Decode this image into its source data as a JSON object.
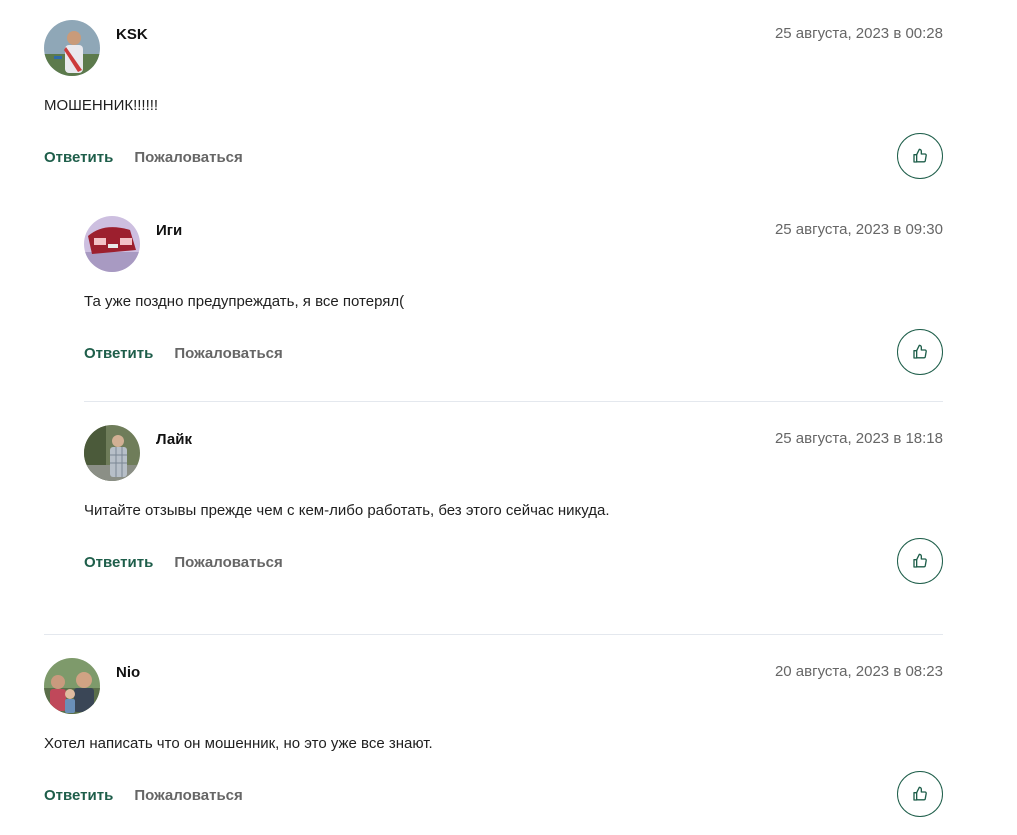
{
  "comments": [
    {
      "author": "KSK",
      "date": "25 августа, 2023 в 00:28",
      "text": "МОШЕННИК!!!!!!",
      "reply_label": "Ответить",
      "report_label": "Пожаловаться",
      "avatar_icon": "user-photo-avatar"
    },
    {
      "author": "Иги",
      "date": "25 августа, 2023 в 09:30",
      "text": "Та уже поздно предупреждать, я все потерял(",
      "reply_label": "Ответить",
      "report_label": "Пожаловаться",
      "avatar_icon": "car-photo-avatar"
    },
    {
      "author": "Лайк",
      "date": "25 августа, 2023 в 18:18",
      "text": "Читайте отзывы прежде чем с кем-либо работать, без этого сейчас никуда.",
      "reply_label": "Ответить",
      "report_label": "Пожаловаться",
      "avatar_icon": "user-photo-avatar"
    },
    {
      "author": "Nio",
      "date": "20 августа, 2023 в 08:23",
      "text": "Хотел написать что он мошенник, но это уже все знают.",
      "reply_label": "Ответить",
      "report_label": "Пожаловаться",
      "avatar_icon": "group-photo-avatar"
    }
  ],
  "colors": {
    "accent": "#1e5e4a",
    "muted_text": "#666666",
    "divider": "#e4e8ee"
  },
  "like_icon": "thumbs-up-icon"
}
